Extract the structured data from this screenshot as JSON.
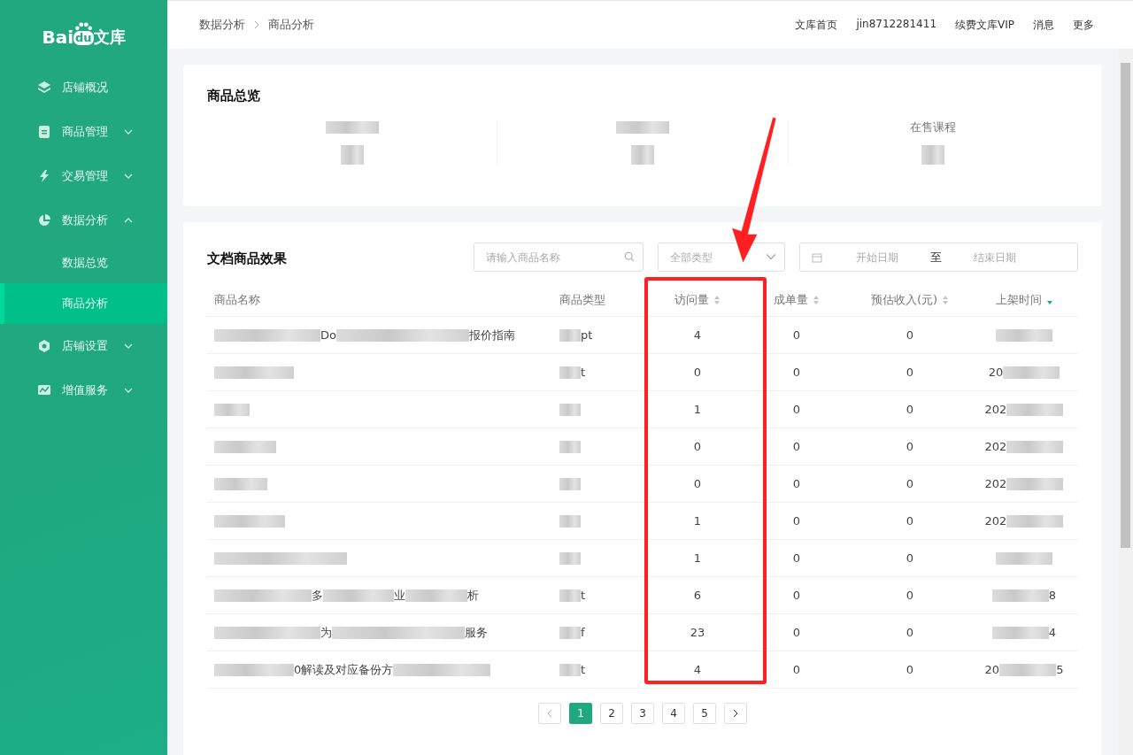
{
  "sidebar": {
    "logo": {
      "latin": "Bai",
      "badge": "du",
      "cjk": "文库"
    },
    "items": [
      {
        "label": "店铺概况"
      },
      {
        "label": "商品管理",
        "expanded": false
      },
      {
        "label": "交易管理",
        "expanded": false
      },
      {
        "label": "数据分析",
        "expanded": true,
        "children": [
          {
            "label": "数据总览",
            "selected": false
          },
          {
            "label": "商品分析",
            "selected": true
          }
        ]
      },
      {
        "label": "店铺设置",
        "expanded": false
      },
      {
        "label": "增值服务",
        "expanded": false
      }
    ]
  },
  "breadcrumb": [
    "数据分析",
    "商品分析"
  ],
  "top_links": [
    "文库首页",
    "jin8712281411",
    "续费文库VIP",
    "消息",
    "更多"
  ],
  "overview": {
    "title": "商品总览",
    "stats": [
      {
        "label": [
          {
            "kind": "blur"
          }
        ],
        "value": [
          {
            "kind": "blur"
          }
        ]
      },
      {
        "label": [
          {
            "kind": "blur"
          }
        ],
        "value": [
          {
            "kind": "blur"
          }
        ]
      },
      {
        "label": [
          {
            "kind": "text",
            "text": "在售课程"
          }
        ],
        "value": [
          {
            "kind": "blur"
          }
        ]
      }
    ]
  },
  "results": {
    "title": "文档商品效果",
    "search": {
      "placeholder": "请输入商品名称"
    },
    "type_select": {
      "placeholder": "全部类型"
    },
    "date_range": {
      "start_placeholder": "开始日期",
      "separator": "至",
      "end_placeholder": "结束日期"
    },
    "columns": [
      {
        "label": "商品名称",
        "sortable": false,
        "highlighted": false
      },
      {
        "label": "商品类型",
        "sortable": false,
        "highlighted": false
      },
      {
        "label": "访问量",
        "sortable": true,
        "sorted": false,
        "highlighted": true
      },
      {
        "label": "成单量",
        "sortable": true,
        "sorted": false,
        "highlighted": false
      },
      {
        "label": "预估收入(元)",
        "sortable": true,
        "sorted": false,
        "highlighted": false
      },
      {
        "label": "上架时间",
        "sortable": true,
        "sorted": true,
        "highlighted": false
      }
    ],
    "rows": [
      {
        "name": [
          {
            "kind": "blur"
          },
          {
            "kind": "text",
            "text": "Do"
          },
          {
            "kind": "blur"
          },
          {
            "kind": "text",
            "text": "报价指南"
          }
        ],
        "type": [
          {
            "kind": "blur"
          },
          {
            "kind": "text",
            "text": "pt"
          }
        ],
        "visits": "4",
        "orders": "0",
        "revenue": "0",
        "date": [
          {
            "kind": "blur"
          }
        ]
      },
      {
        "name": [
          {
            "kind": "blur"
          }
        ],
        "type": [
          {
            "kind": "blur"
          },
          {
            "kind": "text",
            "text": "t"
          }
        ],
        "visits": "0",
        "orders": "0",
        "revenue": "0",
        "date": [
          {
            "kind": "text",
            "text": "20"
          },
          {
            "kind": "blur"
          }
        ]
      },
      {
        "name": [
          {
            "kind": "blur"
          }
        ],
        "type": [
          {
            "kind": "blur"
          }
        ],
        "visits": "1",
        "orders": "0",
        "revenue": "0",
        "date": [
          {
            "kind": "text",
            "text": "202"
          },
          {
            "kind": "blur"
          }
        ]
      },
      {
        "name": [
          {
            "kind": "blur"
          }
        ],
        "type": [
          {
            "kind": "blur"
          }
        ],
        "visits": "0",
        "orders": "0",
        "revenue": "0",
        "date": [
          {
            "kind": "text",
            "text": "202"
          },
          {
            "kind": "blur"
          }
        ]
      },
      {
        "name": [
          {
            "kind": "blur"
          }
        ],
        "type": [
          {
            "kind": "blur"
          }
        ],
        "visits": "0",
        "orders": "0",
        "revenue": "0",
        "date": [
          {
            "kind": "text",
            "text": "202"
          },
          {
            "kind": "blur"
          }
        ]
      },
      {
        "name": [
          {
            "kind": "blur"
          }
        ],
        "type": [
          {
            "kind": "blur"
          }
        ],
        "visits": "1",
        "orders": "0",
        "revenue": "0",
        "date": [
          {
            "kind": "text",
            "text": "202"
          },
          {
            "kind": "blur"
          }
        ]
      },
      {
        "name": [
          {
            "kind": "blur"
          }
        ],
        "type": [
          {
            "kind": "blur"
          }
        ],
        "visits": "1",
        "orders": "0",
        "revenue": "0",
        "date": [
          {
            "kind": "blur"
          }
        ]
      },
      {
        "name": [
          {
            "kind": "blur"
          },
          {
            "kind": "text",
            "text": "多"
          },
          {
            "kind": "blur"
          },
          {
            "kind": "text",
            "text": "业"
          },
          {
            "kind": "blur"
          },
          {
            "kind": "text",
            "text": "析"
          }
        ],
        "type": [
          {
            "kind": "blur"
          },
          {
            "kind": "text",
            "text": "t"
          }
        ],
        "visits": "6",
        "orders": "0",
        "revenue": "0",
        "date": [
          {
            "kind": "blur"
          },
          {
            "kind": "text",
            "text": "8"
          }
        ]
      },
      {
        "name": [
          {
            "kind": "blur"
          },
          {
            "kind": "text",
            "text": "为"
          },
          {
            "kind": "blur"
          },
          {
            "kind": "text",
            "text": "服务"
          }
        ],
        "type": [
          {
            "kind": "blur"
          },
          {
            "kind": "text",
            "text": "f"
          }
        ],
        "visits": "23",
        "orders": "0",
        "revenue": "0",
        "date": [
          {
            "kind": "blur"
          },
          {
            "kind": "text",
            "text": "4"
          }
        ]
      },
      {
        "name": [
          {
            "kind": "blur"
          },
          {
            "kind": "text",
            "text": "0解读及对应备份方"
          },
          {
            "kind": "blur"
          }
        ],
        "type": [
          {
            "kind": "blur"
          },
          {
            "kind": "text",
            "text": "t"
          }
        ],
        "visits": "4",
        "orders": "0",
        "revenue": "0",
        "date": [
          {
            "kind": "text",
            "text": "20"
          },
          {
            "kind": "blur"
          },
          {
            "kind": "text",
            "text": "5"
          }
        ]
      }
    ],
    "pagination": [
      {
        "label": "1",
        "selected": true
      },
      {
        "label": "2",
        "selected": false
      },
      {
        "label": "3",
        "selected": false
      },
      {
        "label": "4",
        "selected": false
      },
      {
        "label": "5",
        "selected": false
      }
    ]
  },
  "annotation": {
    "kind": "arrow_and_box"
  }
}
